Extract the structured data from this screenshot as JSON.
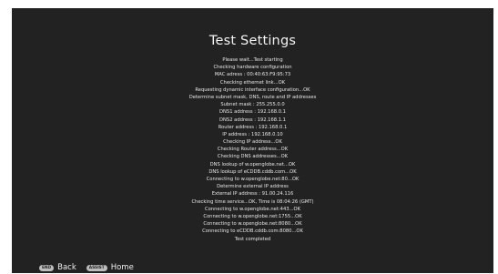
{
  "screen": {
    "title": "Test Settings",
    "log_lines": [
      "Please wait...Test starting",
      "Checking hardware configuration",
      "MAC adress : 00:40:63:F9:95:73",
      "Checking ethernet link...OK",
      "Requesting dynamic interface configuration...OK",
      "Determine subnet mask, DNS, route and IP addresses",
      "Subnet mask : 255.255.0.0",
      "DNS1 address : 192.168.0.1",
      "DNS2 address : 192.168.1.1",
      "Router address : 192.168.0.1",
      "IP address : 192.168.0.10",
      "Checking IP address...OK",
      "Checking Router address...OK",
      "Checking DNS addresses...OK",
      "DNS lookup of w.openglobe.net...OK",
      "DNS lookup of eCDDB.cddb.com...OK",
      "Connecting to w.openglobe.net:80...OK",
      "Determine external IP address",
      "External IP address : 91.00.24.116",
      "Checking time service...OK, Time is 08:04:26 (GMT)",
      "Connecting to w.openglobe.net:443...OK",
      "Connecting to w.openglobe.net:1755...OK",
      "Connecting to w.openglobe.net:8080...OK",
      "Connecting to eCDDB.cddb.com:8080...OK",
      "Test completed"
    ]
  },
  "footer": {
    "back": {
      "key": "END",
      "label": "Back"
    },
    "home": {
      "key": "ASSIST",
      "label": "Home"
    }
  },
  "colors": {
    "background": "#222222",
    "text": "#e6e6e6",
    "key_badge": "#bdbdbd"
  }
}
